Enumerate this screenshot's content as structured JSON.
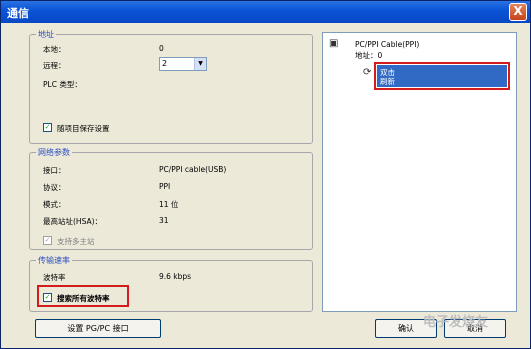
{
  "window": {
    "title": "通信",
    "close": "X"
  },
  "address": {
    "legend": "地址",
    "local_label": "本地：",
    "local_value": "0",
    "remote_label": "远程：",
    "remote_value": "2",
    "plc_type_label": "PLC 类型：",
    "save_checkbox_label": "随项目保存设置"
  },
  "network": {
    "legend": "网络参数",
    "rows": [
      {
        "label": "接口：",
        "value": "PC/PPI cable(USB)"
      },
      {
        "label": "协议：",
        "value": "PPI"
      },
      {
        "label": "模式：",
        "value": "11 位"
      },
      {
        "label": "最高站址(HSA)：",
        "value": "31"
      }
    ],
    "multi_master_label": "支持多主站"
  },
  "baud": {
    "legend": "传输速率",
    "rate_label": "波特率",
    "rate_value": "9.6 kbps",
    "search_label": "搜索所有波特率"
  },
  "tree": {
    "root_label": "PC/PPI Cable(PPI)",
    "address_label": "地址：0",
    "selected_line1": "双击",
    "selected_line2": "刷新"
  },
  "buttons": {
    "set_pgpc": "设置 PG/PC 接口",
    "ok": "确认",
    "cancel": "取消"
  },
  "watermark": "电子发烧友"
}
